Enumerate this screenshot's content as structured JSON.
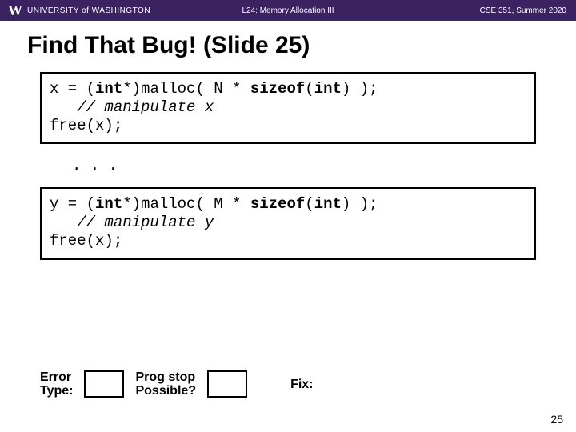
{
  "header": {
    "institution": "UNIVERSITY of WASHINGTON",
    "lecture": "L24: Memory Allocation III",
    "course": "CSE 351, Summer 2020"
  },
  "title": "Find That Bug!  (Slide 25)",
  "code_block_1": {
    "line1_pre": "x = (",
    "line1_kw1": "int",
    "line1_mid": "*)malloc( N * ",
    "line1_kw2": "sizeof",
    "line1_mid2": "(",
    "line1_kw3": "int",
    "line1_post": ") );",
    "line2": "   // manipulate x",
    "line3": "free(x);"
  },
  "ellipsis": ". . .",
  "code_block_2": {
    "line1_pre": "y = (",
    "line1_kw1": "int",
    "line1_mid": "*)malloc( M * ",
    "line1_kw2": "sizeof",
    "line1_mid2": "(",
    "line1_kw3": "int",
    "line1_post": ") );",
    "line2": "   // manipulate y",
    "line3": "free(x);"
  },
  "bottom": {
    "error_type_label": "Error\nType:",
    "prog_stop_label": "Prog stop\nPossible?",
    "fix_label": "Fix:"
  },
  "page_number": "25"
}
